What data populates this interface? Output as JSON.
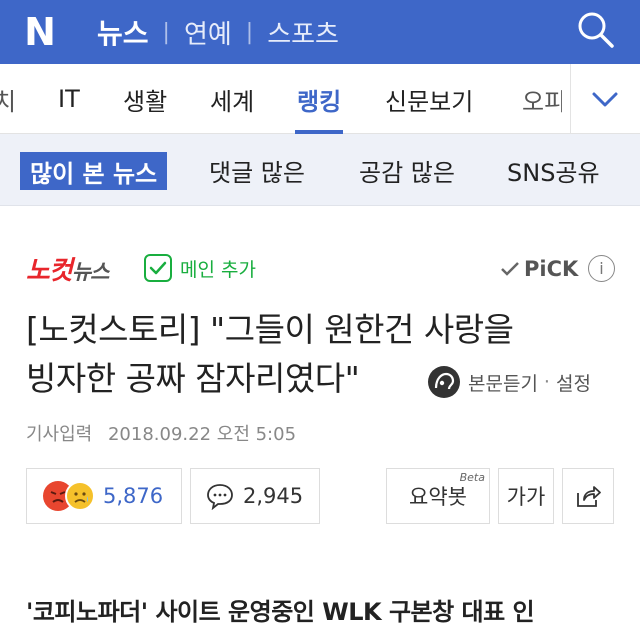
{
  "header": {
    "logo": "N",
    "nav": [
      "뉴스",
      "연예",
      "스포츠"
    ],
    "search_icon": "search-icon",
    "colors": {
      "brand": "#3e67c8"
    }
  },
  "categories": {
    "items": [
      "IT",
      "생활",
      "세계",
      "랭킹",
      "신문보기"
    ],
    "active": "랭킹",
    "clipped_left": "치",
    "clipped_right": "오피"
  },
  "subtabs": {
    "items": [
      "많이 본 뉴스",
      "댓글 많은",
      "공감 많은",
      "SNS공유"
    ],
    "active": "많이 본 뉴스"
  },
  "article": {
    "publisher": "노컷뉴스",
    "publisher_a": "노컷",
    "publisher_b": "뉴스",
    "main_add": "메인 추가",
    "pick": "PiCK",
    "info": "i",
    "title_line1": "[노컷스토리] \"그들이 원한건 사랑을",
    "title_line2": "빙자한 공짜 잠자리였다\"",
    "listen": "본문듣기",
    "settings": "설정",
    "date_label": "기사입력",
    "date": "2018.09.22 오전 5:05",
    "reactions": "5,876",
    "comments": "2,945",
    "summary": "요약봇",
    "summary_beta": "Beta",
    "font": "가가",
    "lead": "'코피노파더' 사이트 운영중인 WLK 구본창 대표 인"
  }
}
